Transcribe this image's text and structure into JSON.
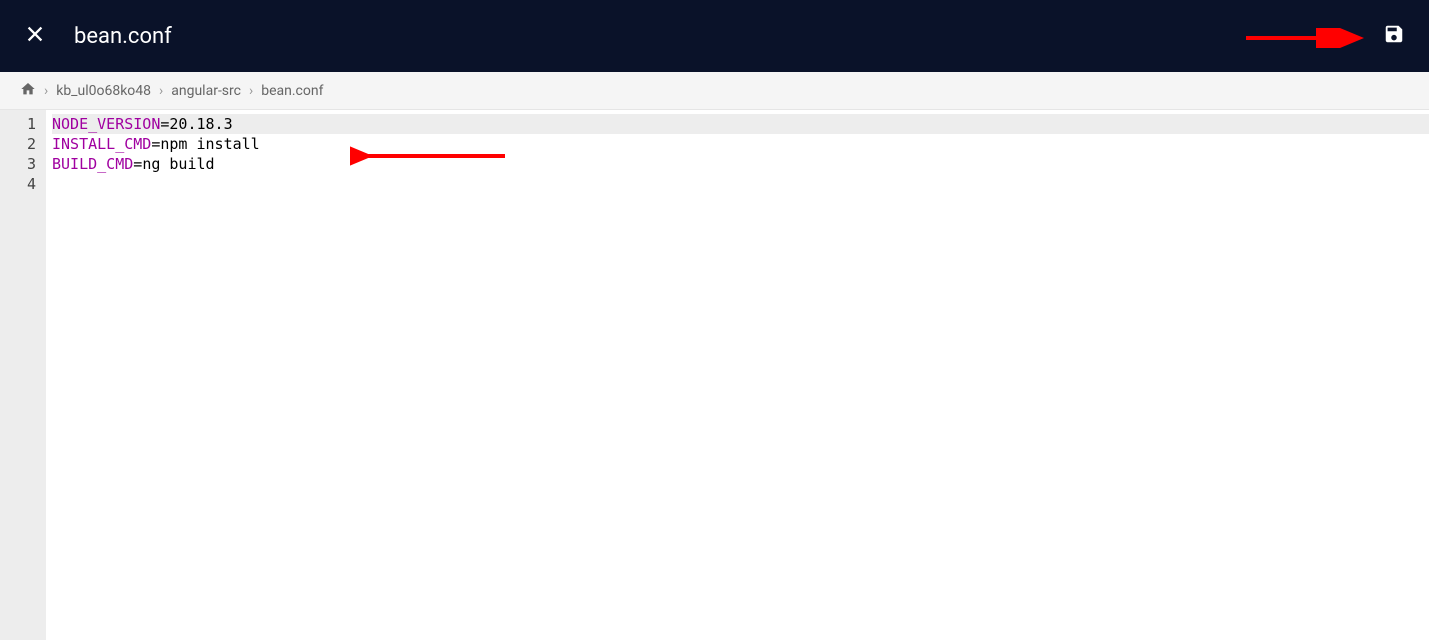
{
  "header": {
    "title": "bean.conf"
  },
  "breadcrumb": {
    "items": [
      "kb_ul0o68ko48",
      "angular-src",
      "bean.conf"
    ]
  },
  "editor": {
    "gutter": [
      "1",
      "2",
      "3",
      "4"
    ],
    "lines": [
      {
        "var": "NODE_VERSION",
        "eq": "=",
        "val": "20.18.3",
        "highlighted": true
      },
      {
        "var": "INSTALL_CMD",
        "eq": "=",
        "val": "npm install",
        "highlighted": false
      },
      {
        "var": "BUILD_CMD",
        "eq": "=",
        "val": "ng build",
        "highlighted": false
      },
      {
        "var": "",
        "eq": "",
        "val": "",
        "highlighted": false
      }
    ]
  }
}
